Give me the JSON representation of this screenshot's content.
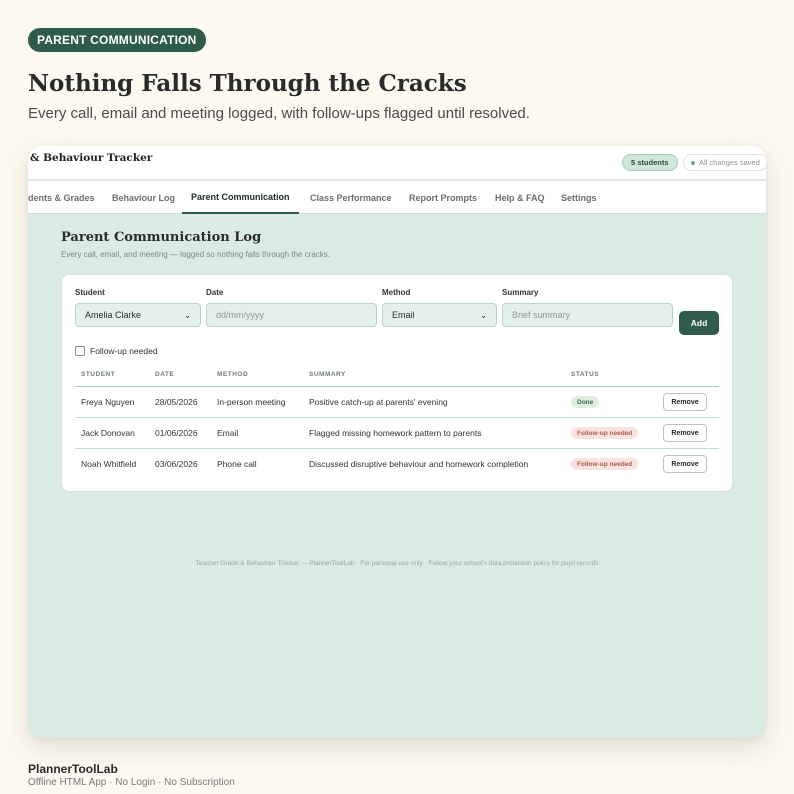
{
  "hero": {
    "badge": "PARENT COMMUNICATION",
    "title": "Nothing Falls Through the Cracks",
    "subtitle": "Every call, email and meeting logged, with follow-ups flagged until resolved."
  },
  "app": {
    "title": "& Behaviour Tracker",
    "students_pill": "5 students",
    "saved_status": "All changes saved",
    "tabs": [
      {
        "label": "dents & Grades",
        "active": false
      },
      {
        "label": "Behaviour Log",
        "active": false
      },
      {
        "label": "Parent Communication",
        "active": true
      },
      {
        "label": "Class Performance",
        "active": false
      },
      {
        "label": "Report Prompts",
        "active": false
      },
      {
        "label": "Help & FAQ",
        "active": false
      },
      {
        "label": "Settings",
        "active": false
      }
    ]
  },
  "log": {
    "title": "Parent Communication Log",
    "subtitle": "Every call, email, and meeting — logged so nothing falls through the cracks.",
    "form": {
      "student_label": "Student",
      "student_value": "Amelia Clarke",
      "date_label": "Date",
      "date_placeholder": "dd/mm/yyyy",
      "method_label": "Method",
      "method_value": "Email",
      "summary_label": "Summary",
      "summary_placeholder": "Brief summary",
      "add_label": "Add",
      "followup_label": "Follow-up needed"
    },
    "columns": [
      "STUDENT",
      "DATE",
      "METHOD",
      "SUMMARY",
      "STATUS"
    ],
    "rows": [
      {
        "student": "Freya Nguyen",
        "date": "28/05/2026",
        "method": "In-person meeting",
        "summary": "Positive catch-up at parents' evening",
        "status": "Done",
        "action": "Remove"
      },
      {
        "student": "Jack Donovan",
        "date": "01/06/2026",
        "method": "Email",
        "summary": "Flagged missing homework pattern to parents",
        "status": "Follow-up needed",
        "action": "Remove"
      },
      {
        "student": "Noah Whitfield",
        "date": "03/06/2026",
        "method": "Phone call",
        "summary": "Discussed disruptive behaviour and homework completion",
        "status": "Follow-up needed",
        "action": "Remove"
      }
    ],
    "footer": "Teacher Grade & Behaviour Tracker — PlannerToolLab · For personal use only · Follow your school's data protection policy for pupil records"
  },
  "brand": {
    "name": "PlannerToolLab",
    "tagline": "Offline HTML App · No Login · No Subscription"
  },
  "colors": {
    "accent": "#2f5b4a",
    "panel": "#d9ebe2",
    "background": "#fcf9f1",
    "done": "#3e6b4e",
    "follow_up": "#b2564b"
  }
}
